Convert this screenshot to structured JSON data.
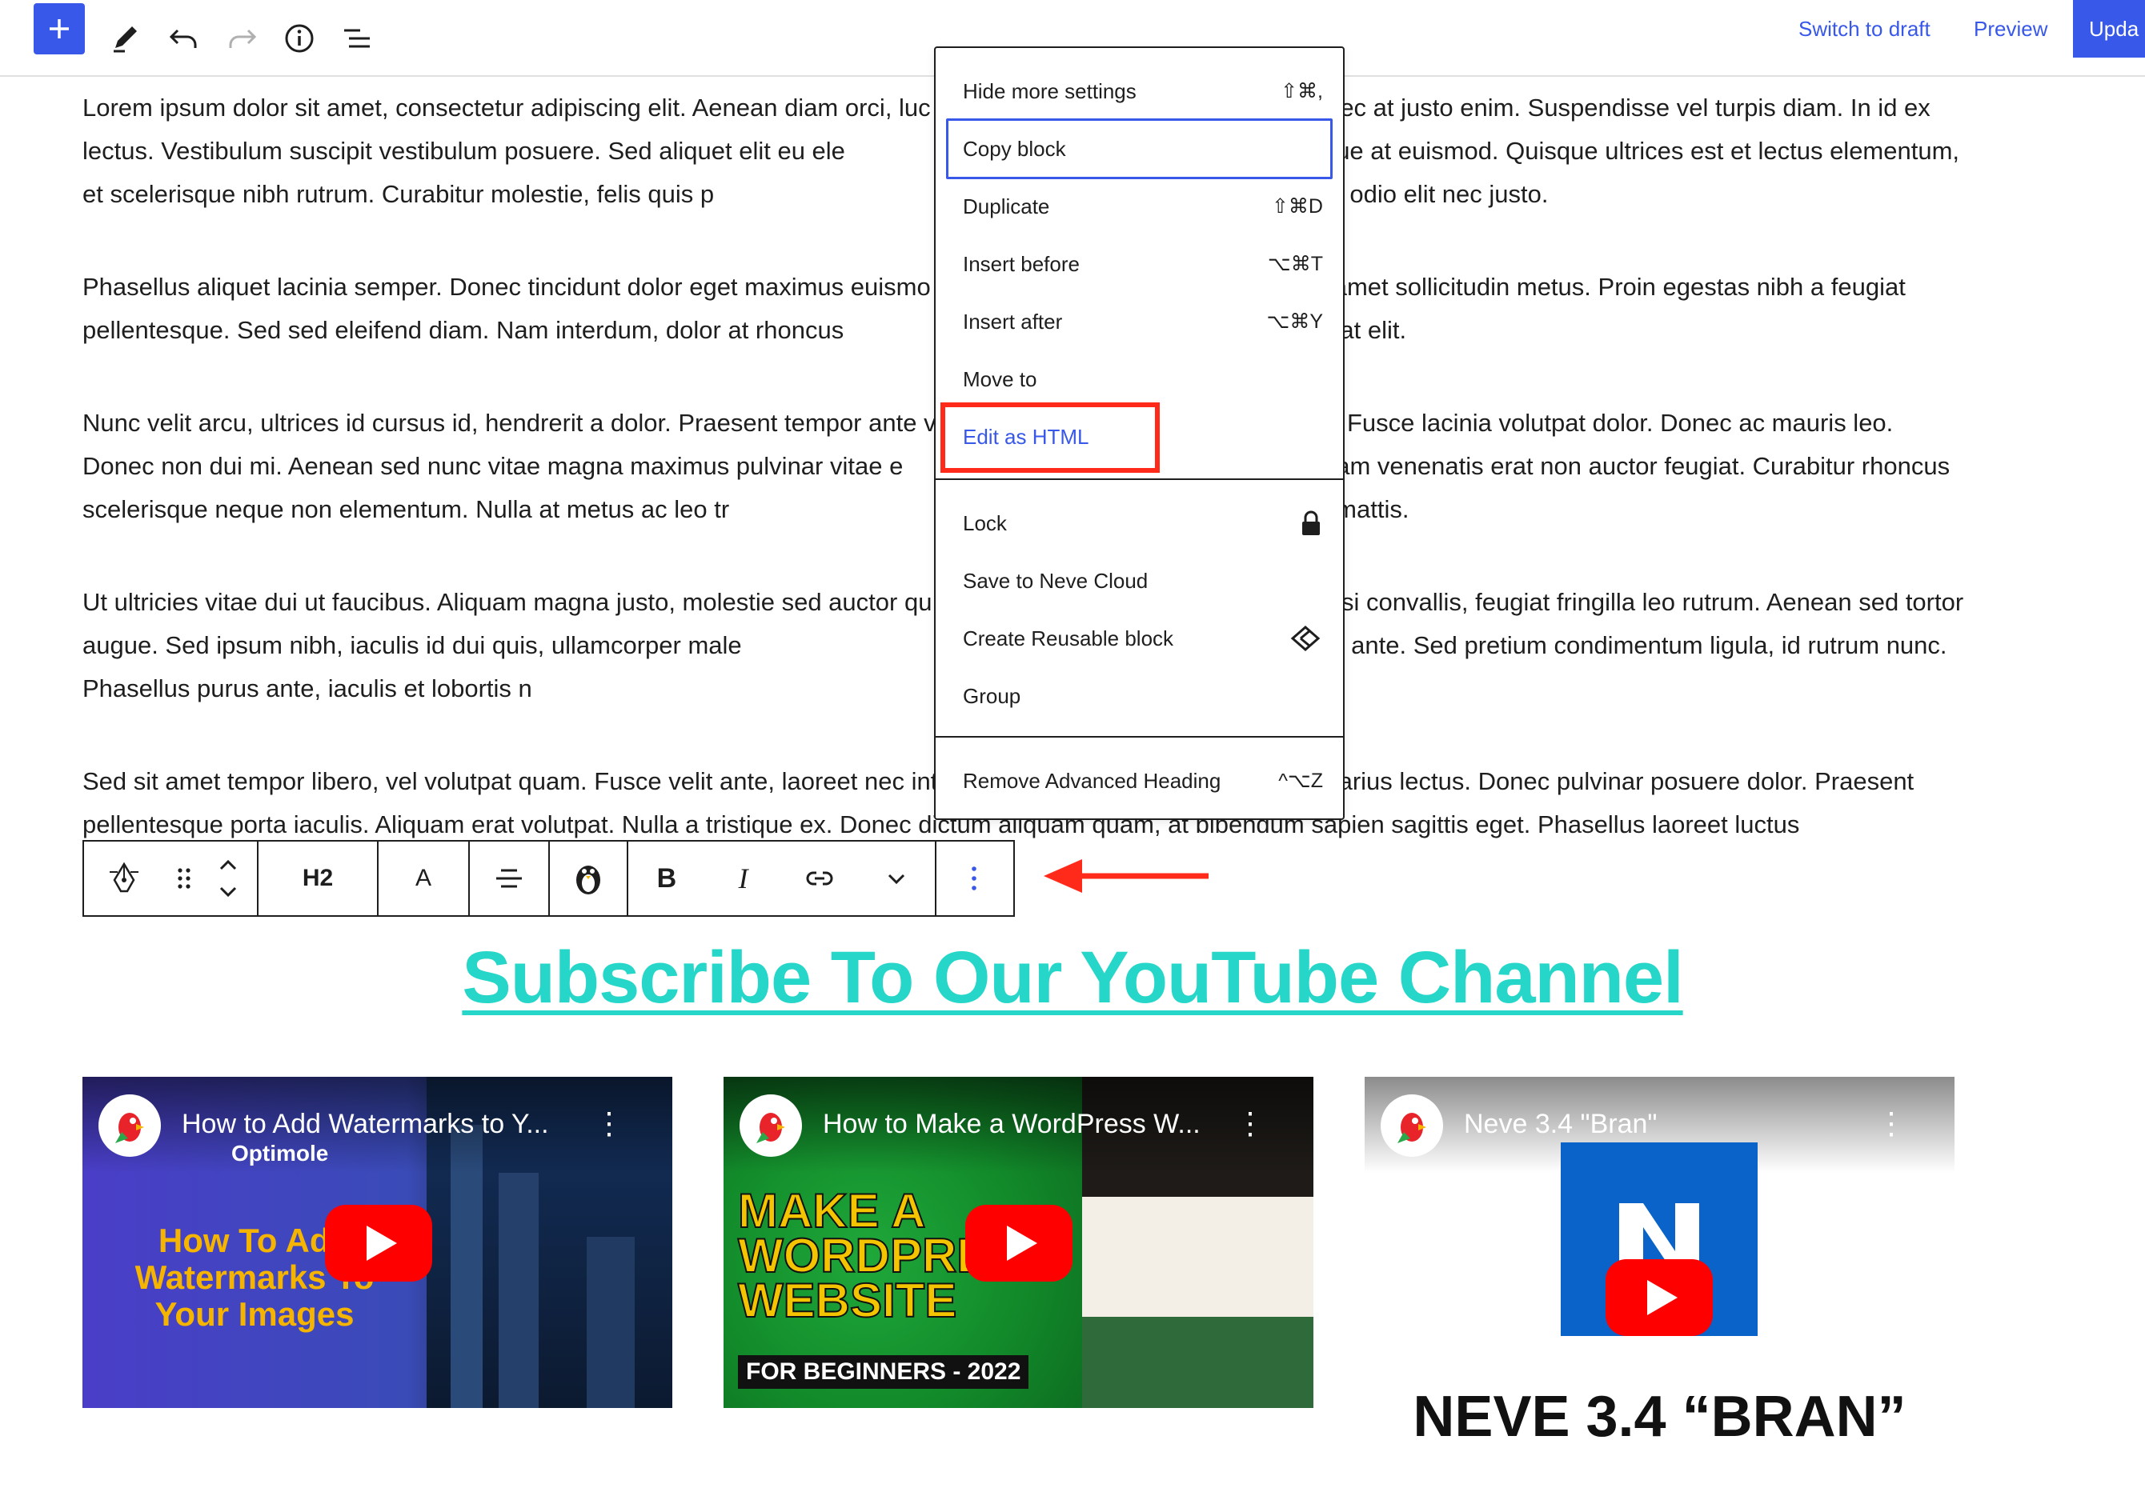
{
  "topbar": {
    "switch_to_draft": "Switch to draft",
    "preview": "Preview",
    "update": "Upda"
  },
  "paragraphs": [
    "Lorem ipsum dolor sit amet, consectetur adipiscing elit. Aenean diam orci, luc                                             t ex. Donec at justo enim. Suspendisse vel turpis diam. In id ex lectus. Vestibulum suscipit vestibulum posuere. Sed aliquet elit eu ele                                             us maximus neque at euismod. Quisque ultrices est et lectus elementum, et scelerisque nibh rutrum. Curabitur molestie, felis quis p                                             mentum nulla, at consectetur odio elit nec justo.",
    "Phasellus aliquet lacinia semper. Donec tincidunt dolor eget maximus euismo                                             ulum sit amet sollicitudin metus. Proin egestas nibh a feugiat pellentesque. Sed sed eleifend diam. Nam interdum, dolor at rhoncus                                             vehicula mi arcu at elit.",
    "Nunc velit arcu, ultrices id cursus id, hendrerit a dolor. Praesent tempor ante v                                             volutpat. Fusce lacinia volutpat dolor. Donec ac mauris leo. Donec non dui mi. Aenean sed nunc vitae magna maximus pulvinar vitae e                                             us dui. Nullam venenatis erat non auctor feugiat. Curabitur rhoncus scelerisque neque non elementum. Nulla at metus ac leo tr                                             ellus at risus in erat iaculis mattis.",
    "Ut ultricies vitae dui ut faucibus. Aliquam magna justo, molestie sed auctor qu                                             ris sed nisi convallis, feugiat fringilla leo rutrum. Aenean sed tortor augue. Sed ipsum nibh, iaculis id dui quis, ullamcorper male                                             t erat eget, aliquam dictum ante. Sed pretium condimentum ligula, id rutrum nunc. Phasellus purus ante, iaculis et lobortis n",
    "Sed sit amet tempor libero, vel volutpat quam. Fusce velit ante, laoreet nec int                                             c vitae varius lectus. Donec pulvinar posuere dolor. Praesent pellentesque porta iaculis. Aliquam erat volutpat. Nulla a tristique ex. Donec dictum aliquam quam, at bibendum sapien sagittis eget. Phasellus laoreet luctus"
  ],
  "block_toolbar": {
    "heading_level": "H2",
    "text_color": "A"
  },
  "heading": "Subscribe To Our YouTube Channel",
  "videos": [
    {
      "title": "How to Add Watermarks to Y...",
      "channel": "Optimole",
      "thumb_text": "How To Add Watermarks To Your Images"
    },
    {
      "title": "How to Make a WordPress W...",
      "thumb_big": "MAKE A WORDPRESS WEBSITE",
      "thumb_sub": "FOR BEGINNERS - 2022"
    },
    {
      "title": "Neve 3.4 \"Bran\"",
      "thumb_text": "NEVE 3.4 “BRAN”"
    }
  ],
  "menu": {
    "items": [
      {
        "label": "Hide more settings",
        "shortcut": "⇧⌘,"
      },
      {
        "label": "Copy block",
        "shortcut": ""
      },
      {
        "label": "Duplicate",
        "shortcut": "⇧⌘D"
      },
      {
        "label": "Insert before",
        "shortcut": "⌥⌘T"
      },
      {
        "label": "Insert after",
        "shortcut": "⌥⌘Y"
      },
      {
        "label": "Move to",
        "shortcut": ""
      },
      {
        "label": "Edit as HTML",
        "shortcut": ""
      }
    ],
    "items2": [
      {
        "label": "Lock",
        "icon": "lock-icon"
      },
      {
        "label": "Save to Neve Cloud",
        "icon": ""
      },
      {
        "label": "Create Reusable block",
        "icon": "reusable-block-icon"
      },
      {
        "label": "Group",
        "icon": ""
      }
    ],
    "items3": [
      {
        "label": "Remove Advanced Heading",
        "shortcut": "^⌥Z"
      }
    ]
  },
  "colors": {
    "accent": "#3858e9",
    "heading": "#26d6c9",
    "highlight": "#ff2a1a"
  }
}
